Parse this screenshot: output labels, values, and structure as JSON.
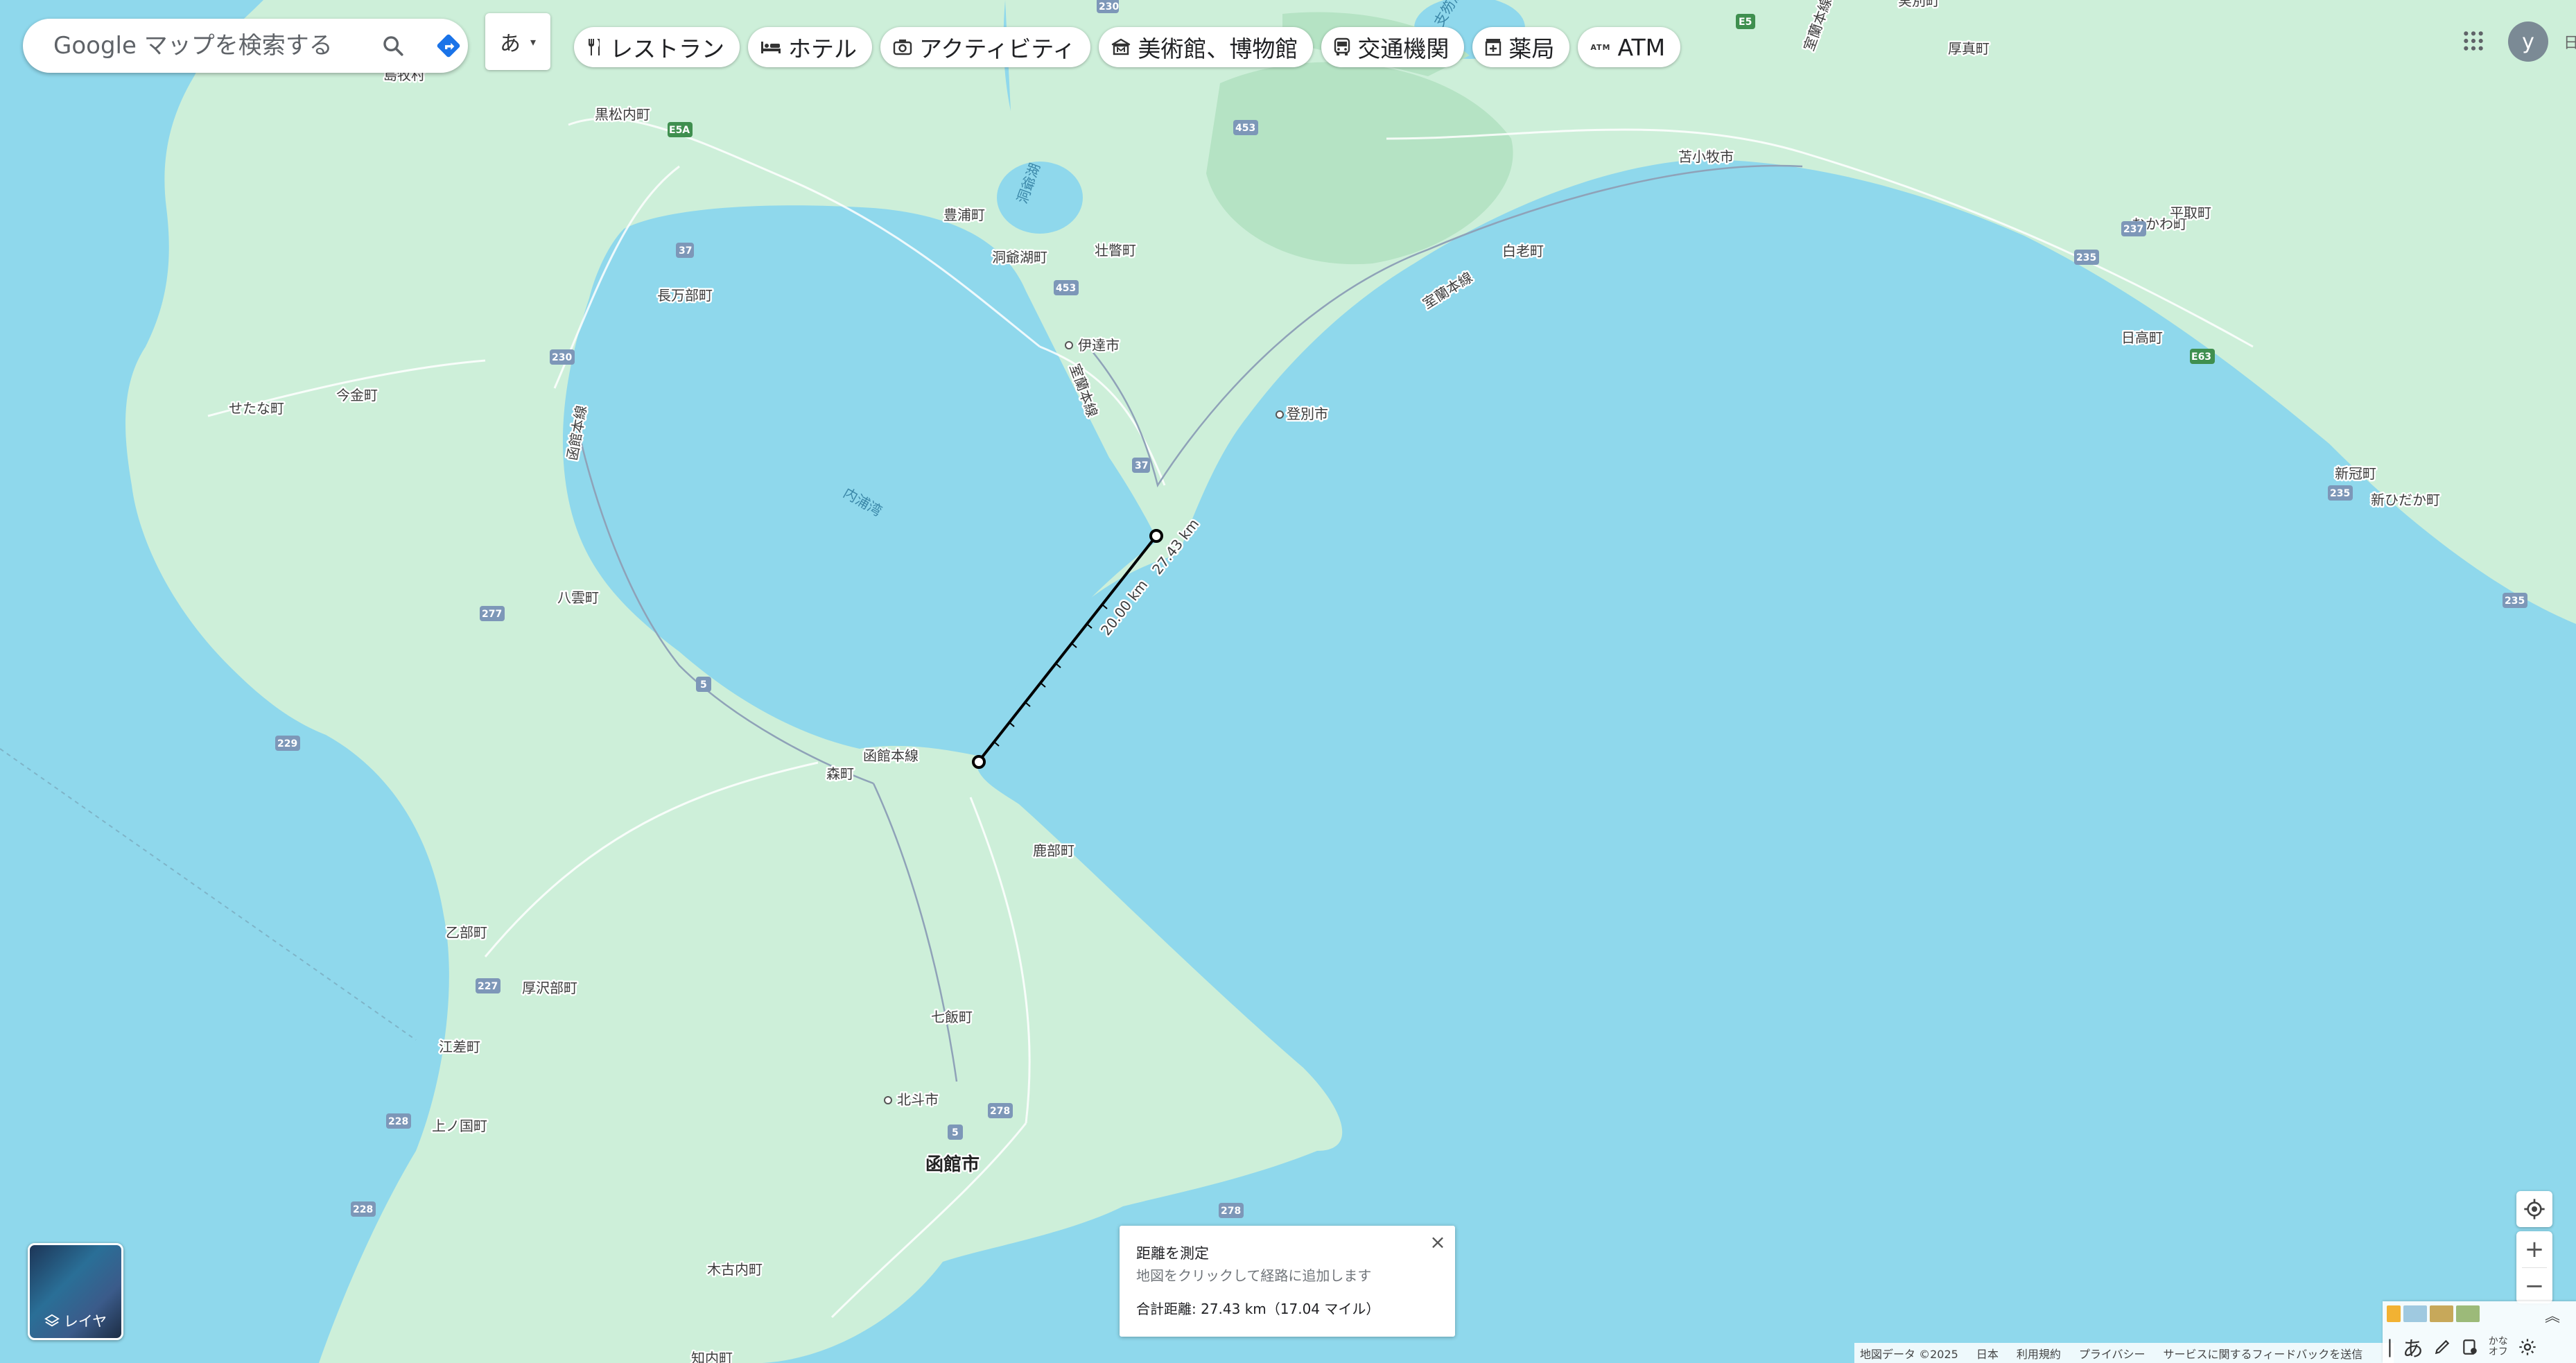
{
  "search": {
    "placeholder": "Google マップを検索する"
  },
  "ime": {
    "label": "あ"
  },
  "chips": [
    {
      "label": "レストラン",
      "icon": "fork-knife-icon"
    },
    {
      "label": "ホテル",
      "icon": "bed-icon"
    },
    {
      "label": "アクティビティ",
      "icon": "camera-icon"
    },
    {
      "label": "美術館、博物館",
      "icon": "museum-icon"
    },
    {
      "label": "交通機関",
      "icon": "bus-icon"
    },
    {
      "label": "薬局",
      "icon": "pharmacy-icon"
    },
    {
      "label": "ATM",
      "icon": "atm-icon"
    }
  ],
  "user": {
    "initial": "y",
    "corner_text": "日"
  },
  "layers": {
    "label": "レイヤ"
  },
  "measure": {
    "title": "距離を測定",
    "hint": "地図をクリックして経路に追加します",
    "total": "合計距離: 27.43 km（17.04 マイル）",
    "close": "×"
  },
  "map": {
    "segment_labels": {
      "mid": "20.00 km",
      "end": "27.43 km"
    },
    "places": [
      "島牧村",
      "黒松内町",
      "長万部町",
      "今金町",
      "せたな町",
      "八雲町",
      "森町",
      "鹿部町",
      "乙部町",
      "厚沢部町",
      "江差町",
      "上ノ国町",
      "七飯町",
      "北斗市",
      "函館市",
      "木古内町",
      "豊浦町",
      "洞爺湖町",
      "壮瞥町",
      "伊達市",
      "登別市",
      "白老町",
      "苫小牧市",
      "厚真町",
      "むかわ町",
      "平取町",
      "日高町",
      "新冠町",
      "新ひだか町",
      "知内町",
      "実別町"
    ],
    "water": [
      "内浦湾",
      "洞爺湖",
      "支笏湖"
    ],
    "rail": [
      "函館本線",
      "室蘭本線",
      "函館本線",
      "室蘭本線",
      "室蘭本線"
    ],
    "routes": [
      "230",
      "E5A",
      "453",
      "37",
      "453",
      "230",
      "229",
      "277",
      "5",
      "227",
      "228",
      "228",
      "5",
      "278",
      "278",
      "E5",
      "235",
      "237",
      "E63",
      "235",
      "235",
      "37"
    ]
  },
  "attribution": {
    "map_data": "地図データ ©2025",
    "country": "日本",
    "terms": "利用規約",
    "privacy": "プライバシー",
    "feedback": "サービスに関するフィードバックを送信"
  },
  "tray": {
    "ime": "あ",
    "kana_top": "かな",
    "kana_bottom": "オフ"
  },
  "colors": {
    "water": "#8fd8ec",
    "land": "#cdefd9",
    "accent_blue": "#1a73e8"
  }
}
